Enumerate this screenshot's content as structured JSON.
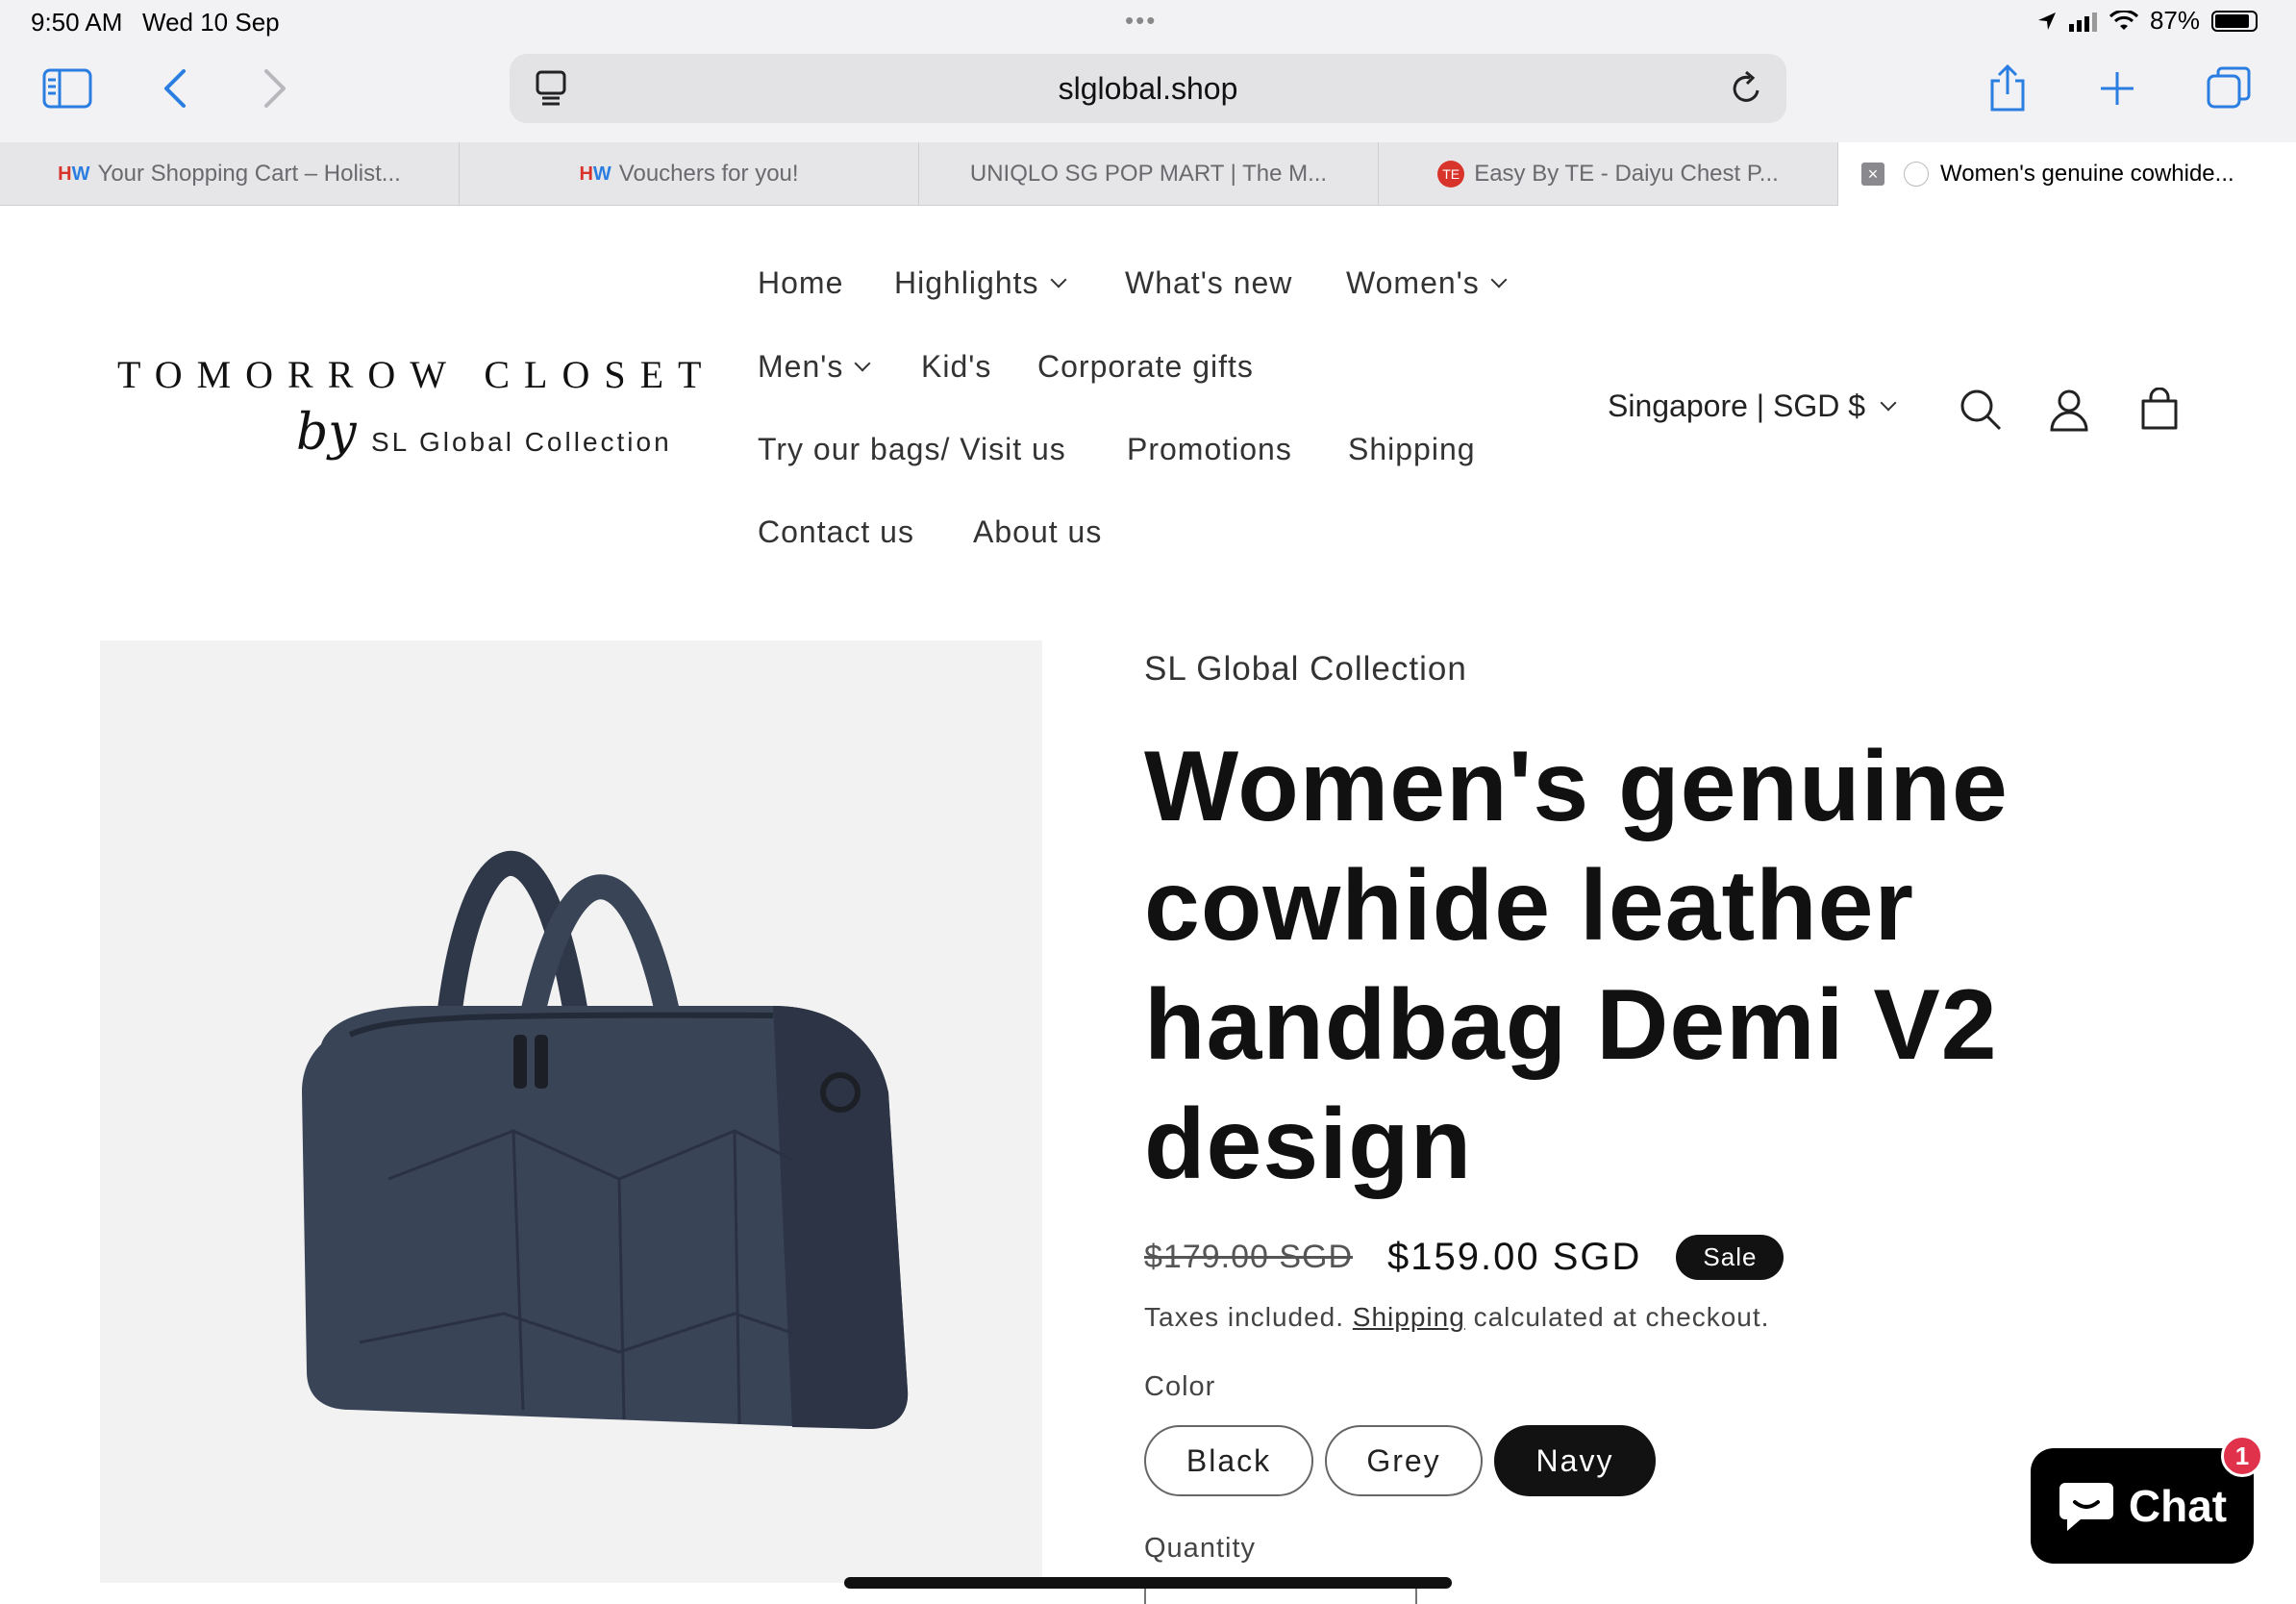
{
  "status_bar": {
    "time": "9:50 AM",
    "date": "Wed 10 Sep",
    "battery": "87%"
  },
  "browser": {
    "url": "slglobal.shop",
    "tabs": [
      {
        "icon": "HW",
        "label": "Your Shopping Cart – Holist..."
      },
      {
        "icon": "HW",
        "label": "Vouchers for you!"
      },
      {
        "icon": "",
        "label": "UNIQLO SG POP MART | The M..."
      },
      {
        "icon": "TE",
        "label": "Easy By TE - Daiyu Chest P..."
      },
      {
        "icon": "",
        "label": "Women's genuine cowhide..."
      }
    ]
  },
  "header": {
    "logo_main": "TOMORROW CLOSET",
    "logo_by": "by",
    "logo_sub": "SL Global Collection",
    "nav": {
      "home": "Home",
      "highlights": "Highlights",
      "whats_new": "What's new",
      "womens": "Women's",
      "mens": "Men's",
      "kids": "Kid's",
      "corporate_gifts": "Corporate gifts",
      "try_bags": "Try our bags/ Visit us",
      "promotions": "Promotions",
      "shipping": "Shipping",
      "contact": "Contact us",
      "about": "About us"
    },
    "locale": "Singapore | SGD $"
  },
  "product": {
    "vendor": "SL Global Collection",
    "title": "Women's genuine cowhide leather handbag Demi V2 design",
    "price_old": "$179.00 SGD",
    "price_new": "$159.00 SGD",
    "sale_badge": "Sale",
    "taxes_prefix": "Taxes included.",
    "taxes_link": "Shipping",
    "taxes_suffix": "calculated at checkout.",
    "color_label": "Color",
    "colors": [
      "Black",
      "Grey",
      "Navy"
    ],
    "selected_color": "Navy",
    "quantity_label": "Quantity",
    "image_color": "#3a4457"
  },
  "chat": {
    "label": "Chat",
    "badge": "1"
  }
}
